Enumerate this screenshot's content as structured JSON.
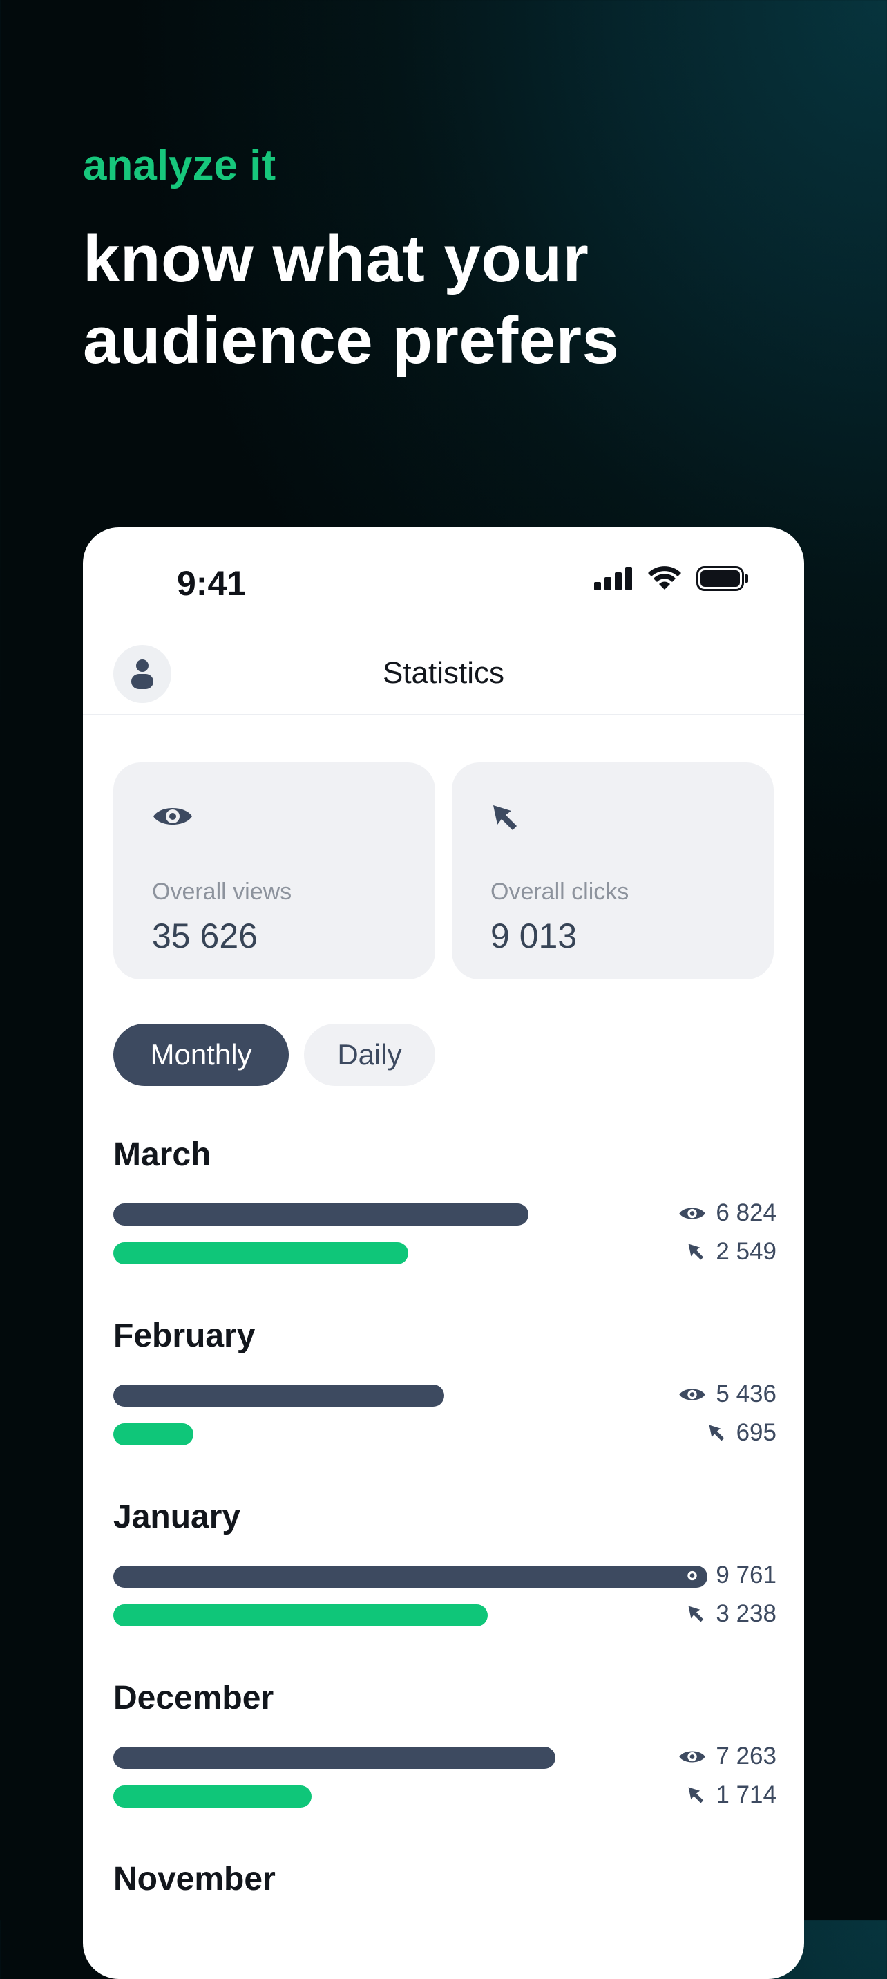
{
  "hero": {
    "eyebrow": "analyze it",
    "title_line1": "know what your",
    "title_line2": "audience prefers"
  },
  "status_bar": {
    "time": "9:41"
  },
  "app": {
    "title": "Statistics"
  },
  "cards": [
    {
      "icon": "eye-icon",
      "label": "Overall views",
      "value": "35 626"
    },
    {
      "icon": "cursor-icon",
      "label": "Overall clicks",
      "value": "9 013"
    }
  ],
  "tabs": [
    {
      "label": "Monthly",
      "active": true
    },
    {
      "label": "Daily",
      "active": false
    }
  ],
  "colors": {
    "accent_green": "#17c77c",
    "bar_views": "#3d4a60",
    "bar_clicks": "#0fc679"
  },
  "chart_data": {
    "type": "bar",
    "categories": [
      "March",
      "February",
      "January",
      "December",
      "November"
    ],
    "series": [
      {
        "values": [
          6824,
          5436,
          9761,
          7263,
          null
        ]
      },
      {
        "values": [
          2549,
          695,
          3238,
          1714,
          null
        ]
      }
    ]
  },
  "months": [
    {
      "name": "March",
      "views": "6 824",
      "clicks": "2 549"
    },
    {
      "name": "February",
      "views": "5 436",
      "clicks": "695"
    },
    {
      "name": "January",
      "views": "9 761",
      "clicks": "3 238"
    },
    {
      "name": "December",
      "views": "7 263",
      "clicks": "1 714"
    },
    {
      "name": "November"
    }
  ]
}
